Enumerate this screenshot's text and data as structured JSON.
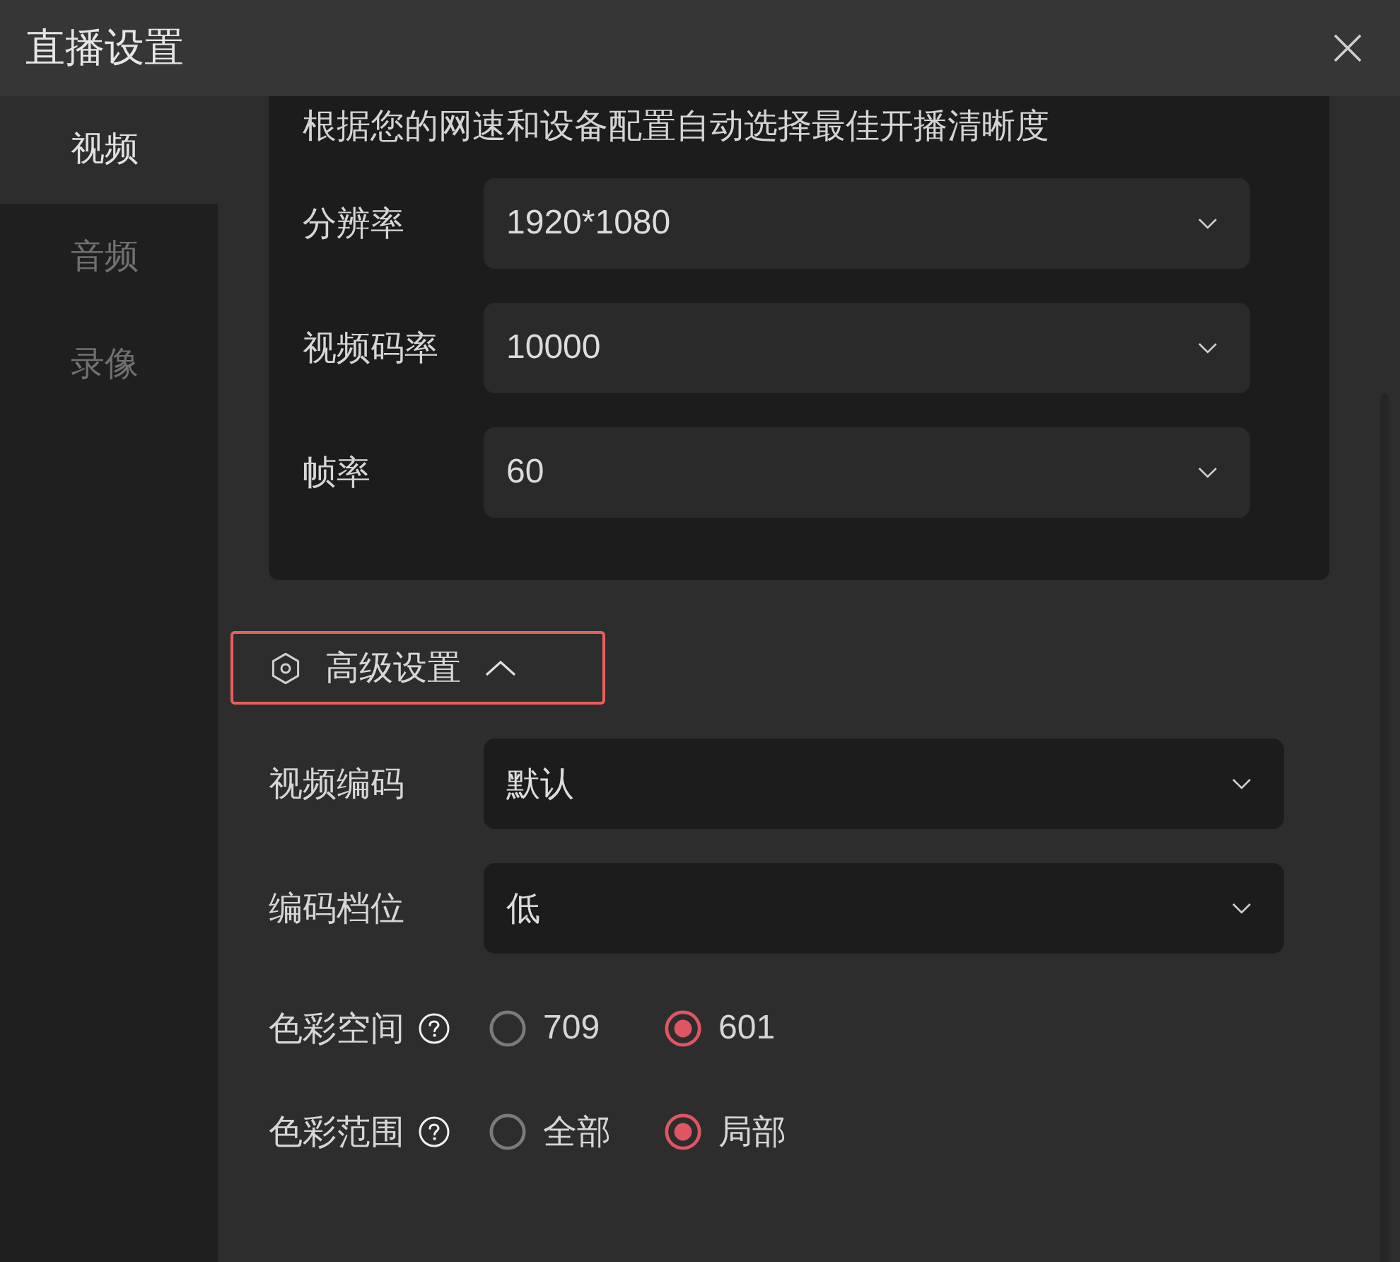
{
  "window": {
    "title": "直播设置"
  },
  "sidebar": {
    "items": [
      {
        "label": "视频",
        "selected": true
      },
      {
        "label": "音频",
        "selected": false
      },
      {
        "label": "录像",
        "selected": false
      }
    ]
  },
  "quality_card": {
    "description": "根据您的网速和设备配置自动选择最佳开播清晰度",
    "fields": [
      {
        "label": "分辨率",
        "value": "1920*1080"
      },
      {
        "label": "视频码率",
        "value": "10000"
      },
      {
        "label": "帧率",
        "value": "60"
      }
    ]
  },
  "advanced": {
    "title": "高级设置",
    "expanded": true,
    "highlighted": true,
    "fields": [
      {
        "kind": "select",
        "label": "视频编码",
        "value": "默认"
      },
      {
        "kind": "select",
        "label": "编码档位",
        "value": "低"
      },
      {
        "kind": "radio",
        "label": "色彩空间",
        "options": [
          {
            "label": "709",
            "selected": false
          },
          {
            "label": "601",
            "selected": true
          }
        ]
      },
      {
        "kind": "radio",
        "label": "色彩范围",
        "options": [
          {
            "label": "全部",
            "selected": false
          },
          {
            "label": "局部",
            "selected": true
          }
        ]
      }
    ]
  }
}
